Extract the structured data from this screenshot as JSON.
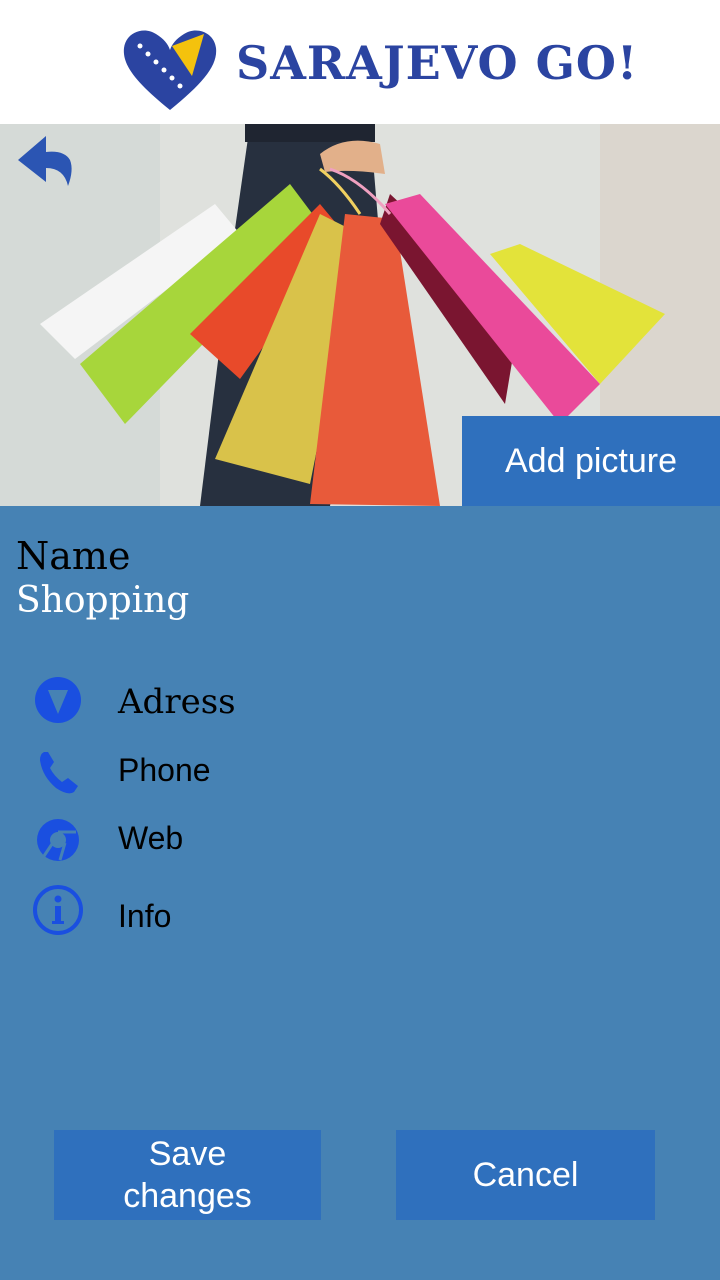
{
  "app": {
    "title": "SARAJEVO GO!"
  },
  "hero": {
    "add_picture_label": "Add picture"
  },
  "detail": {
    "name_label": "Name",
    "name_value": "Shopping",
    "rows": [
      {
        "icon": "location-icon",
        "label": "Adress"
      },
      {
        "icon": "phone-icon",
        "label": "Phone"
      },
      {
        "icon": "web-icon",
        "label": "Web"
      },
      {
        "icon": "info-icon",
        "label": "Info"
      }
    ]
  },
  "actions": {
    "save_label": "Save changes",
    "cancel_label": "Cancel"
  },
  "colors": {
    "background": "#4682b4",
    "button": "#2f70bd",
    "icon_blue": "#1a4fe0",
    "logo_blue": "#2b44a1"
  }
}
